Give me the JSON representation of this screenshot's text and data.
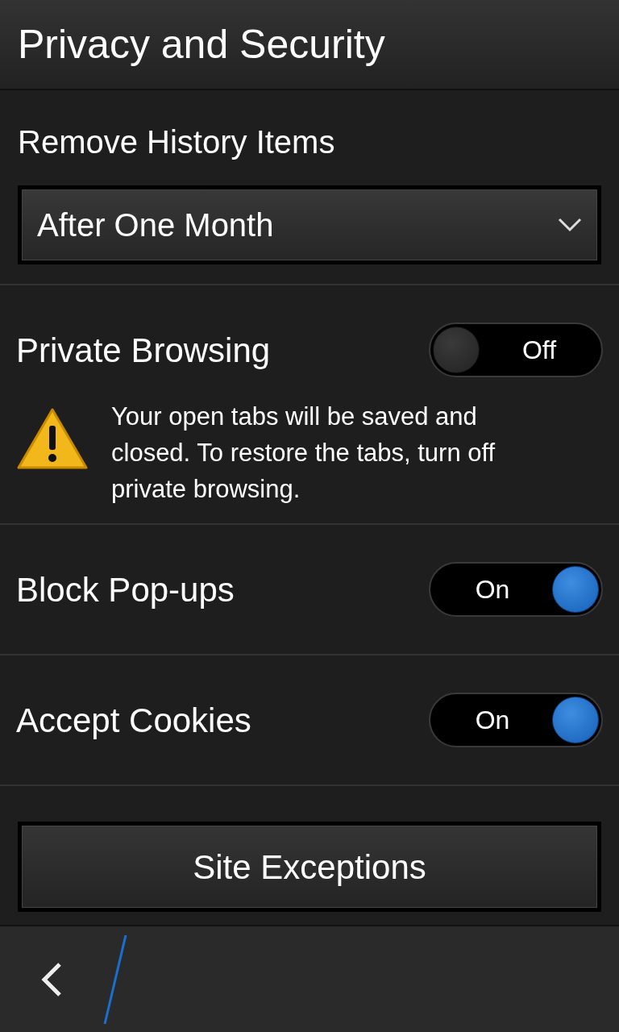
{
  "header": {
    "title": "Privacy and Security"
  },
  "history": {
    "label": "Remove History Items",
    "value": "After One Month"
  },
  "settings": [
    {
      "kind": "toggle",
      "label": "Private Browsing",
      "on": false,
      "state_text": "Off",
      "warning": "Your open tabs will be saved and closed. To restore the tabs, turn off private browsing."
    },
    {
      "kind": "toggle",
      "label": "Block Pop-ups",
      "on": true,
      "state_text": "On"
    },
    {
      "kind": "toggle",
      "label": "Accept Cookies",
      "on": true,
      "state_text": "On"
    }
  ],
  "button": {
    "label": "Site Exceptions"
  }
}
